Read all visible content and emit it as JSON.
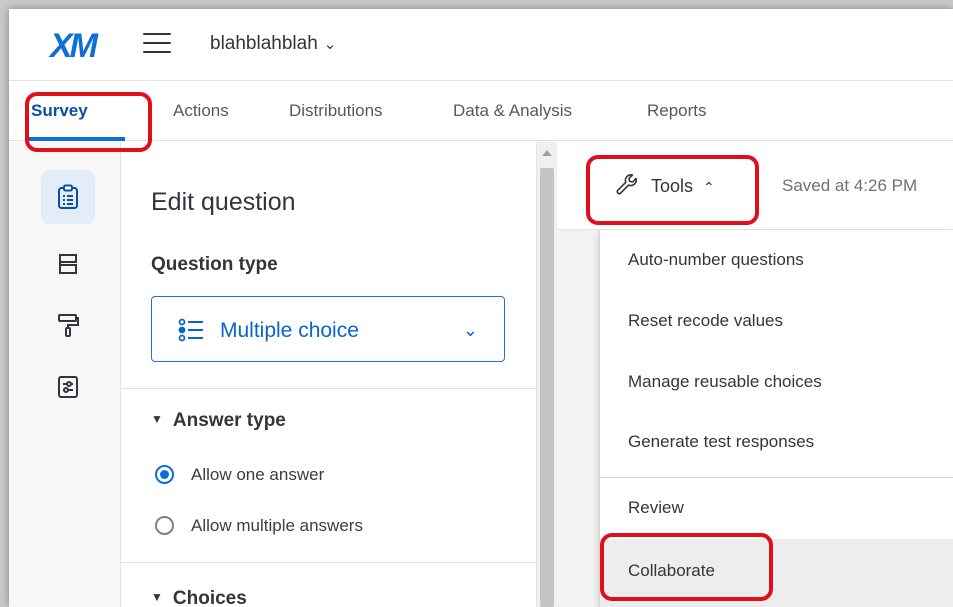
{
  "header": {
    "logo_main": "XM",
    "project_name": "blahblahblah"
  },
  "tabs": [
    {
      "label": "Survey",
      "active": true
    },
    {
      "label": "Actions"
    },
    {
      "label": "Distributions"
    },
    {
      "label": "Data & Analysis"
    },
    {
      "label": "Reports"
    }
  ],
  "rail": {
    "items": [
      {
        "icon": "survey-clipboard-icon",
        "active": true
      },
      {
        "icon": "blocks-layout-icon"
      },
      {
        "icon": "paint-roller-icon"
      },
      {
        "icon": "options-sliders-icon"
      }
    ]
  },
  "edit_panel": {
    "title": "Edit question",
    "question_type_label": "Question type",
    "question_type_value": "Multiple choice",
    "answer_type_label": "Answer type",
    "answer_options": [
      {
        "label": "Allow one answer",
        "selected": true
      },
      {
        "label": "Allow multiple answers",
        "selected": false
      }
    ],
    "choices_label": "Choices"
  },
  "toolbar": {
    "tools_label": "Tools",
    "saved_text": "Saved at 4:26 PM"
  },
  "tools_menu": {
    "items": [
      "Auto-number questions",
      "Reset recode values",
      "Manage reusable choices",
      "Generate test responses",
      "Review",
      "Collaborate"
    ],
    "highlighted": "Collaborate"
  },
  "colors": {
    "brand_blue": "#0b6ed8",
    "annotation_red": "#e0101b",
    "active_tab": "#0b4ea2"
  }
}
